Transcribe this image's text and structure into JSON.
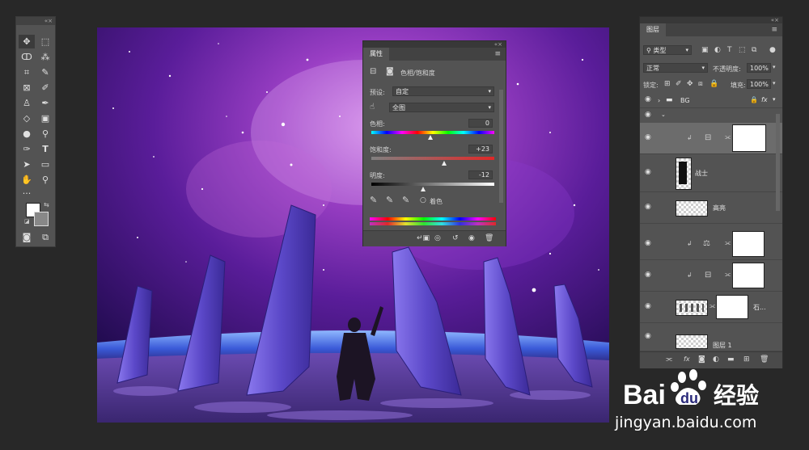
{
  "toolbar": {
    "grip": "«×",
    "tools": [
      "move",
      "marquee",
      "lasso",
      "magic-wand",
      "crop",
      "eyedropper",
      "frame",
      "brush",
      "stamp",
      "history-brush",
      "eraser",
      "gradient",
      "blur",
      "dodge",
      "pen",
      "type",
      "path-select",
      "rectangle",
      "hand",
      "zoom",
      "more",
      "colors",
      "quick-mask",
      "screen-mode"
    ]
  },
  "properties": {
    "tab": "属性",
    "adjustment_title": "色相/饱和度",
    "preset_label": "预设:",
    "preset_value": "自定",
    "channel_value": "全图",
    "hue_label": "色相:",
    "hue_value": "0",
    "saturation_label": "饱和度:",
    "saturation_value": "+23",
    "lightness_label": "明度:",
    "lightness_value": "-12",
    "colorize_label": "着色",
    "slider_levels": {
      "hue": 0,
      "saturation": 23,
      "lightness": -12
    }
  },
  "layers": {
    "tab": "图层",
    "filter_kind": "类型",
    "blend_mode": "正常",
    "opacity_label": "不透明度:",
    "opacity_value": "100%",
    "lock_label": "锁定:",
    "fill_label": "填充:",
    "fill_value": "100%",
    "group_name": "BG",
    "rows": [
      {
        "name": ""
      },
      {
        "name": "战士"
      },
      {
        "name": "高亮"
      },
      {
        "name": ""
      },
      {
        "name": ""
      },
      {
        "name": "石..."
      },
      {
        "name": "图层 1"
      }
    ],
    "fx_label": "fx"
  },
  "watermark": {
    "logo_text_1": "Bai",
    "logo_text_2": "du",
    "logo_cn": "经验",
    "url": "jingyan.baidu.com"
  }
}
